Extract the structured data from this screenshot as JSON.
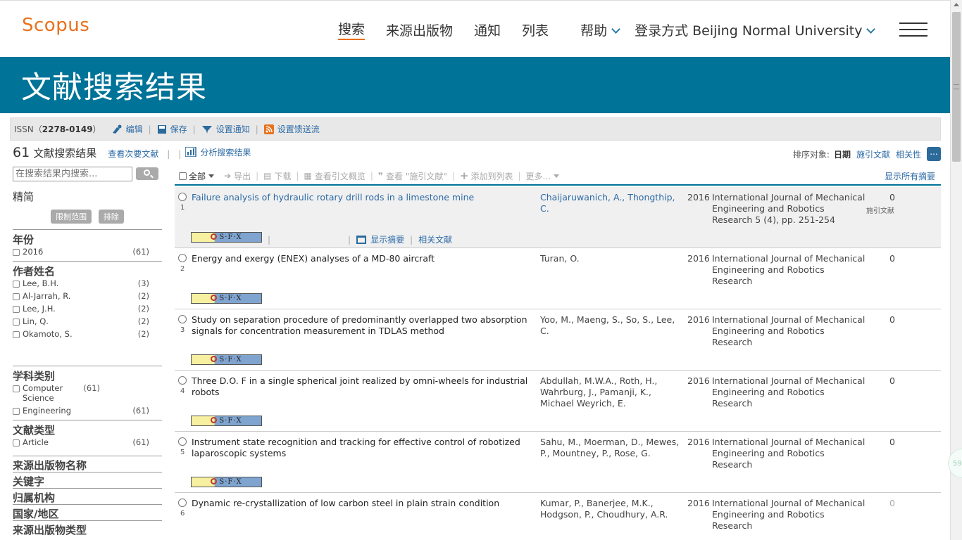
{
  "header": {
    "logo": "Scopus",
    "nav": {
      "search": "搜索",
      "sources": "来源出版物",
      "alerts": "通知",
      "lists": "列表",
      "help": "帮助",
      "login": "登录方式 Beijing Normal University"
    }
  },
  "banner": {
    "title": "文献搜索结果"
  },
  "issn_bar": {
    "issn_label": "ISSN（",
    "issn_value": "2278-0149",
    "issn_close": "）",
    "edit": "编辑",
    "save": "保存",
    "set_alert": "设置通知",
    "set_feed": "设置馈送流"
  },
  "results_header": {
    "count": "61",
    "label": "文献搜索结果",
    "secondary": "查看次要文献",
    "analyze": "分析搜索结果"
  },
  "sort": {
    "label": "排序对象:",
    "active": "日期",
    "cited": "施引文献",
    "relevance": "相关性",
    "more": "..."
  },
  "filter": {
    "search_placeholder": "在搜索结果内搜索...",
    "refine_title": "精简",
    "limit_to": "限制范围",
    "exclude": "排除",
    "year": {
      "title": "年份",
      "items": [
        {
          "name": "2016",
          "count": "(61)"
        }
      ]
    },
    "author": {
      "title": "作者姓名",
      "items": [
        {
          "name": "Lee, B.H.",
          "count": "(3)"
        },
        {
          "name": "Al-Jarrah, R.",
          "count": "(2)"
        },
        {
          "name": "Lee, J.H.",
          "count": "(2)"
        },
        {
          "name": "Lin, Q.",
          "count": "(2)"
        },
        {
          "name": "Okamoto, S.",
          "count": "(2)"
        }
      ]
    },
    "subject": {
      "title": "学科类别",
      "items": [
        {
          "name": "Computer Science",
          "count": "(61)"
        },
        {
          "name": "Engineering",
          "count": "(61)"
        }
      ]
    },
    "doctype": {
      "title": "文献类型",
      "items": [
        {
          "name": "Article",
          "count": "(61)"
        }
      ]
    },
    "more_groups": [
      "来源出版物名称",
      "关键字",
      "归属机构",
      "国家/地区",
      "来源出版物类型"
    ]
  },
  "toolbar": {
    "all": "全部",
    "export": "导出",
    "download": "下载",
    "citation_overview": "查看引文概览",
    "cited_by": "查看 \"施引文献\"",
    "add_to_list": "添加到列表",
    "more": "更多...",
    "show_all_abstracts": "显示所有摘要"
  },
  "results": [
    {
      "num": "1",
      "title": "Failure analysis of hydraulic rotary drill rods in a limestone mine",
      "authors": "Chaijaruwanich, A., Thongthip, C.",
      "year": "2016",
      "source": "International Journal of Mechanical Engineering and Robotics Research 5 (4), pp. 251-254",
      "cited": "0",
      "cited_label": "施引文献",
      "show_abstract": "显示摘要",
      "related": "相关文献"
    },
    {
      "num": "2",
      "title": "Energy and exergy (ENEX) analyses of a MD-80 aircraft",
      "authors": "Turan, O.",
      "year": "2016",
      "source": "International Journal of Mechanical Engineering and Robotics Research",
      "cited": "0"
    },
    {
      "num": "3",
      "title": "Study on separation procedure of predominantly overlapped two absorption signals for concentration measurement in TDLAS method",
      "authors": "Yoo, M., Maeng, S., So, S., Lee, C.",
      "year": "2016",
      "source": "International Journal of Mechanical Engineering and Robotics Research",
      "cited": "0"
    },
    {
      "num": "4",
      "title": "Three D.O. F in a single spherical joint realized by omni-wheels for industrial robots",
      "authors": "Abdullah, M.W.A., Roth, H., Wahrburg, J., Pamanji, K., Michael Weyrich, E.",
      "year": "2016",
      "source": "International Journal of Mechanical Engineering and Robotics Research",
      "cited": "0"
    },
    {
      "num": "5",
      "title": "Instrument state recognition and tracking for effective control of robotized laparoscopic systems",
      "authors": "Sahu, M., Moerman, D., Mewes, P., Mountney, P., Rose, G.",
      "year": "2016",
      "source": "International Journal of Mechanical Engineering and Robotics Research",
      "cited": "0"
    },
    {
      "num": "6",
      "title": "Dynamic re-crystallization of low carbon steel in plain strain condition",
      "authors": "Kumar, P., Banerjee, M.K., Hodgson, P., Choudhury, A.R.",
      "year": "2016",
      "source": "International Journal of Mechanical Engineering and Robotics Research",
      "cited": "0"
    }
  ],
  "sfx_label": "S·F·X",
  "side_bubble": "59",
  "colors": {
    "brand": "#e9711c",
    "banner": "#007398",
    "link": "#2c6aa5"
  }
}
